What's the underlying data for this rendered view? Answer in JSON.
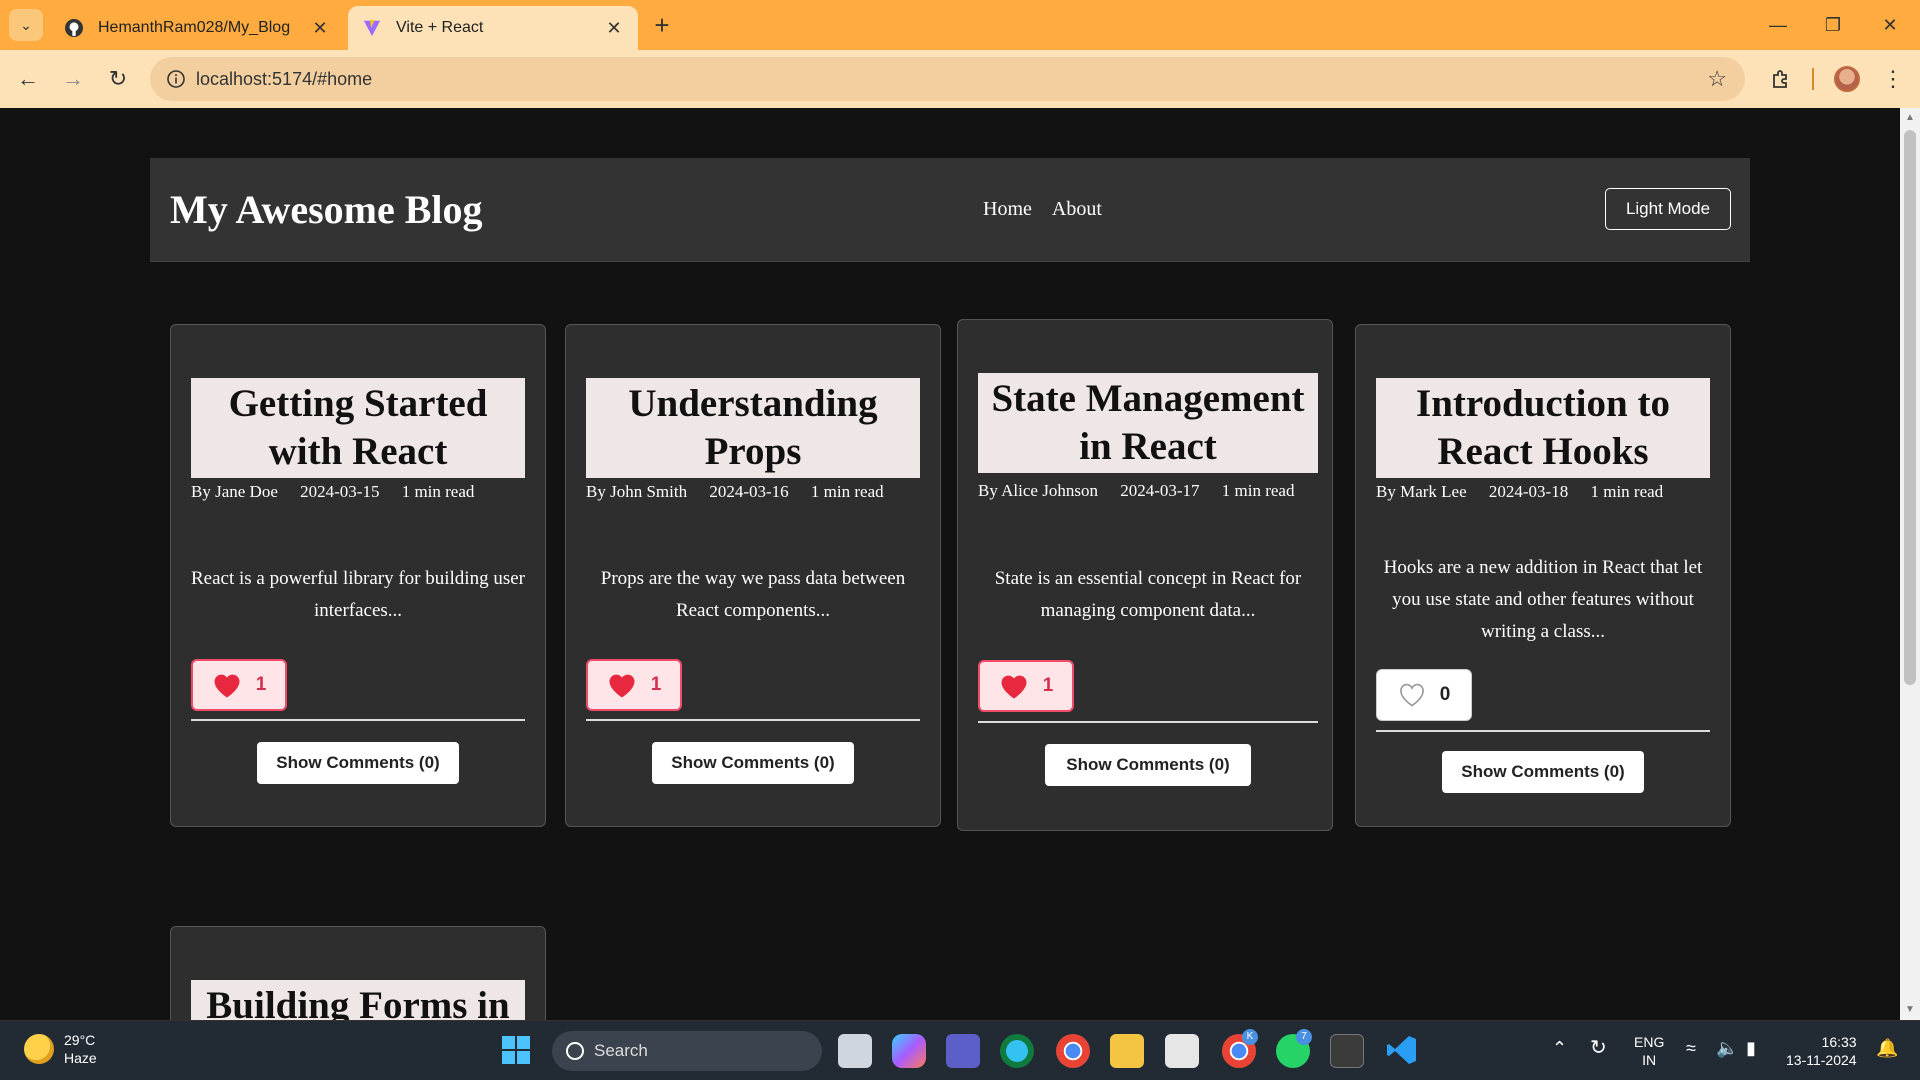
{
  "browser": {
    "tabs": [
      {
        "title": "HemanthRam028/My_Blog",
        "active": false,
        "icon": "github-icon"
      },
      {
        "title": "Vite + React",
        "active": true,
        "icon": "vite-icon"
      }
    ],
    "url": "localhost:5174/#home"
  },
  "blog": {
    "brand": "My Awesome Blog",
    "nav": [
      {
        "label": "Home"
      },
      {
        "label": "About"
      }
    ],
    "mode_toggle": "Light Mode",
    "posts": [
      {
        "title": "Getting Started with React",
        "author": "By Jane Doe",
        "date": "2024-03-15",
        "read": "1 min read",
        "excerpt": "React is a powerful library for building user interfaces...",
        "likes": "1",
        "liked": true,
        "comments": "Show Comments (0)"
      },
      {
        "title": "Understanding Props",
        "author": "By John Smith",
        "date": "2024-03-16",
        "read": "1 min read",
        "excerpt": "Props are the way we pass data between React components...",
        "likes": "1",
        "liked": true,
        "comments": "Show Comments (0)"
      },
      {
        "title": "State Management in React",
        "author": "By Alice Johnson",
        "date": "2024-03-17",
        "read": "1 min read",
        "excerpt": "State is an essential concept in React for managing component data...",
        "likes": "1",
        "liked": true,
        "comments": "Show Comments (0)"
      },
      {
        "title": "Introduction to React Hooks",
        "author": "By Mark Lee",
        "date": "2024-03-18",
        "read": "1 min read",
        "excerpt": "Hooks are a new addition in React that let you use state and other features without writing a class...",
        "likes": "0",
        "liked": false,
        "comments": "Show Comments (0)"
      },
      {
        "title": "Building Forms in"
      }
    ]
  },
  "taskbar": {
    "weather_temp": "29°C",
    "weather_desc": "Haze",
    "search_placeholder": "Search",
    "lang_top": "ENG",
    "lang_bottom": "IN",
    "time": "16:33",
    "date": "13-11-2024",
    "whatsapp_badge": "7",
    "chrome_badge": "K"
  },
  "colors": {
    "tabbar": "#ffab40",
    "toolbar": "#fde2b8",
    "page_bg": "#121212",
    "card_bg": "#2e2e2e",
    "like_accent": "#ef4c6a"
  }
}
